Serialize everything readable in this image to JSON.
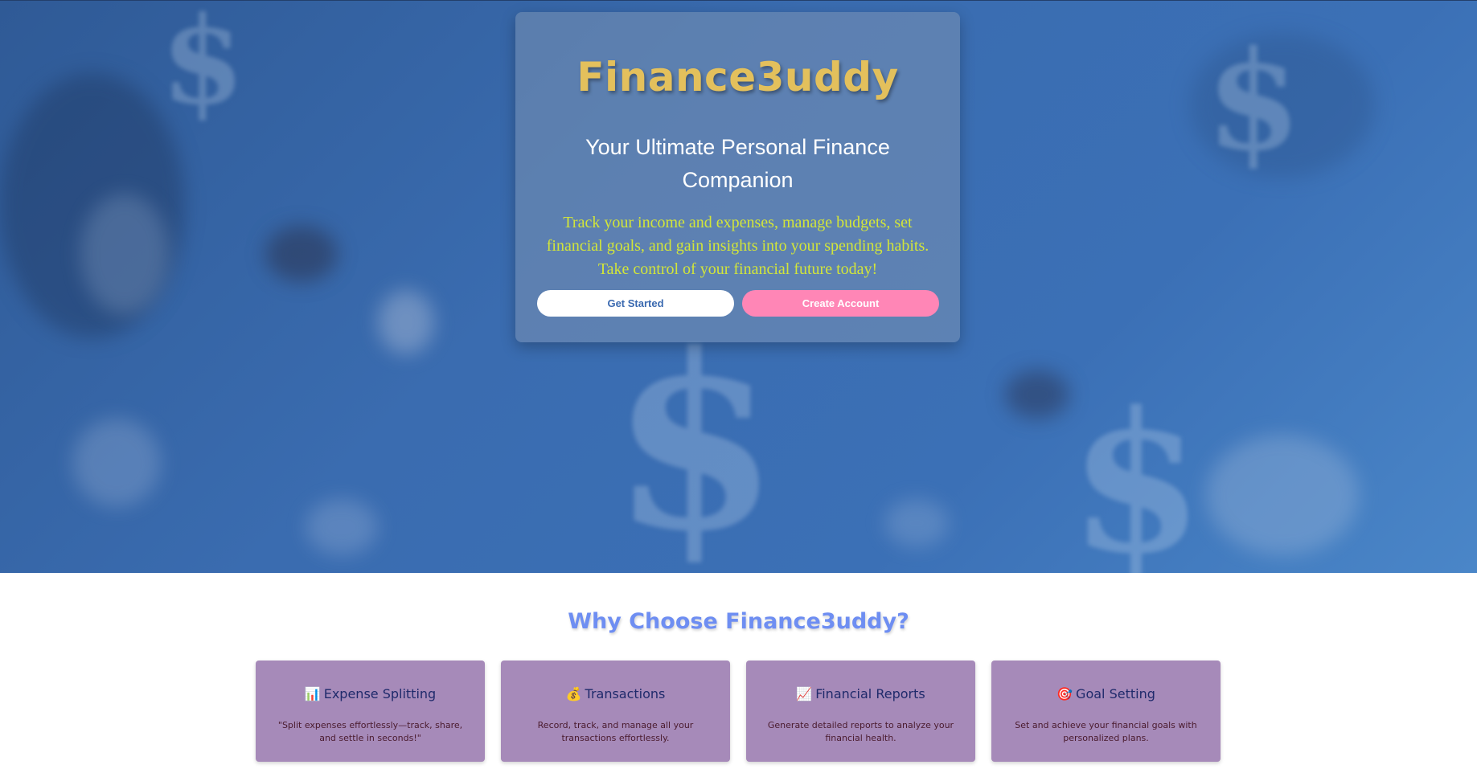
{
  "hero": {
    "brand": "Finance3uddy",
    "subtitle": "Your Ultimate Personal Finance Companion",
    "description": "Track your income and expenses, manage budgets, set financial goals, and gain insights into your spending habits. Take control of your financial future today!",
    "primary_button": "Get Started",
    "secondary_button": "Create Account"
  },
  "features": {
    "title": "Why Choose Finance3uddy?",
    "items": [
      {
        "icon": "📊",
        "icon_name": "bar-chart-icon",
        "title": "Expense Splitting",
        "description": "\"Split expenses effortlessly—track, share, and settle in seconds!\""
      },
      {
        "icon": "💰",
        "icon_name": "money-bag-icon",
        "title": "Transactions",
        "description": "Record, track, and manage all your transactions effortlessly."
      },
      {
        "icon": "📈",
        "icon_name": "chart-increasing-icon",
        "title": "Financial Reports",
        "description": "Generate detailed reports to analyze your financial health."
      },
      {
        "icon": "🎯",
        "icon_name": "target-icon",
        "title": "Goal Setting",
        "description": "Set and achieve your financial goals with personalized plans."
      }
    ]
  },
  "colors": {
    "brand": "#e3c05c",
    "accent_pink": "#ff86b6",
    "feature_card": "#a68ab9",
    "section_title": "#6e8ef2"
  }
}
